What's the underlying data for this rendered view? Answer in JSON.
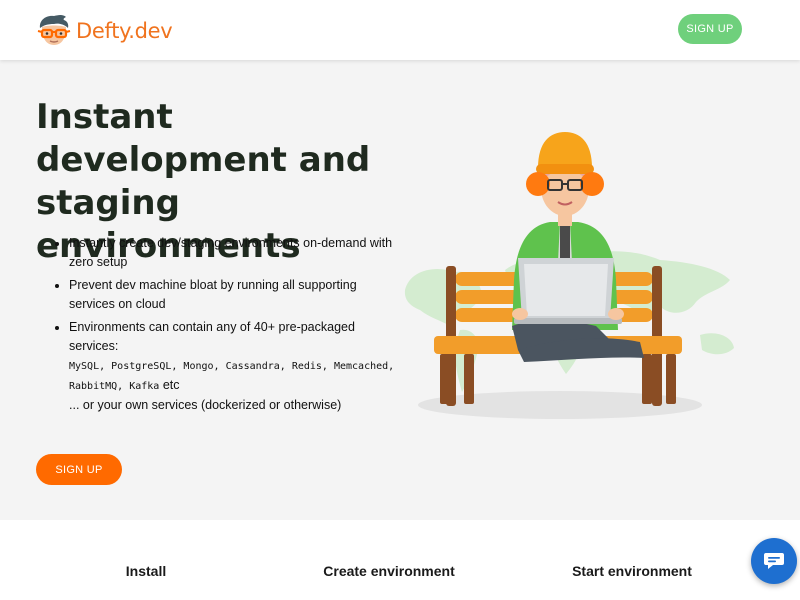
{
  "header": {
    "logo_text": "Defty.dev",
    "signup_label": "SIGN UP"
  },
  "hero": {
    "title": "Instant development and staging environments",
    "features": [
      "Instantly create dev/staging environments on-demand with zero setup",
      "Prevent dev machine bloat by running all supporting services on cloud"
    ],
    "feature_envs_intro": "Environments can contain any of 40+ pre-packaged services:",
    "services": [
      "MySQL",
      "PostgreSQL",
      "Mongo",
      "Cassandra",
      "Redis",
      "Memcached",
      "RabbitMQ",
      "Kafka"
    ],
    "services_suffix": "etc",
    "own_services": "... or your own services (dockerized or otherwise)",
    "signup_label": "SIGN UP"
  },
  "steps": {
    "install": "Install",
    "create": "Create environment",
    "start": "Start environment"
  },
  "colors": {
    "brand_orange": "#f0731e",
    "cta_orange": "#ff6a00",
    "header_signup_green": "#6fd07c",
    "hero_bg": "#f4f4f4",
    "chat_blue": "#1e6fd0"
  },
  "icons": {
    "logo": "developer-face-logo-icon",
    "chat": "chat-bubble-icon"
  },
  "illustration": "developer-with-laptop-on-bench-illustration"
}
